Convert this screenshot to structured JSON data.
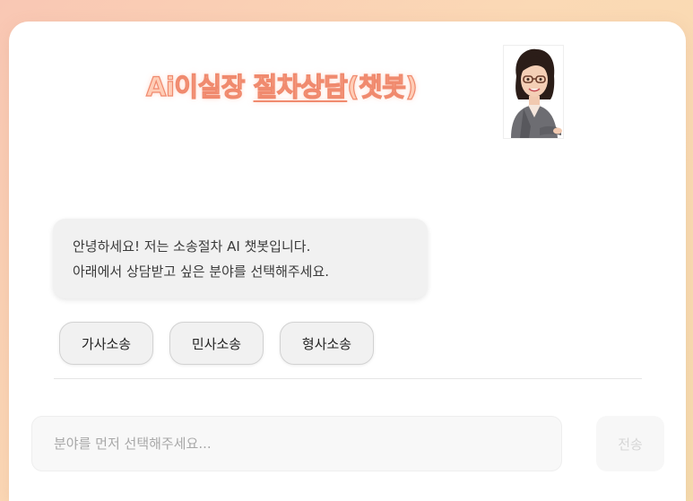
{
  "header": {
    "title_prefix": "Ai이실장 ",
    "title_underlined": "절차상담",
    "title_suffix": "(챗봇)",
    "avatar_icon": "woman-with-glasses-avatar",
    "accent_color": "#f08a6e"
  },
  "chat": {
    "bot_message_line1": "안녕하세요! 저는 소송절차 AI 챗봇입니다.",
    "bot_message_line2": "아래에서 상담받고 싶은 분야를 선택해주세요.",
    "choices": [
      {
        "label": "가사소송"
      },
      {
        "label": "민사소송"
      },
      {
        "label": "형사소송"
      }
    ]
  },
  "footer": {
    "input_placeholder": "분야를 먼저 선택해주세요...",
    "input_value": "",
    "send_label": "전송"
  }
}
